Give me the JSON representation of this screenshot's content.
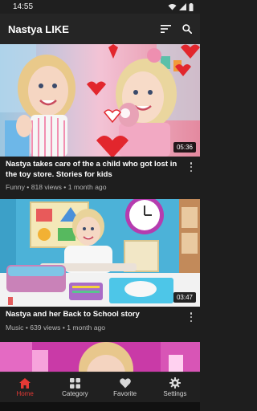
{
  "status": {
    "time": "14:55"
  },
  "app": {
    "title": "Nastya LIKE"
  },
  "videos": [
    {
      "title": "Nastya takes care of the a child who got lost in the toy store. Stories for kids",
      "category": "Funny",
      "views": "818 views",
      "age": "1 month ago",
      "duration": "05:36"
    },
    {
      "title": "Nastya and her Back to School story",
      "category": "Music",
      "views": "639 views",
      "age": "1 month ago",
      "duration": "03:47"
    }
  ],
  "nav": [
    {
      "label": "Home",
      "icon": "home-icon",
      "active": true
    },
    {
      "label": "Category",
      "icon": "grid-icon"
    },
    {
      "label": "Favorite",
      "icon": "heart-icon"
    },
    {
      "label": "Settings",
      "icon": "gear-icon"
    }
  ],
  "colors": {
    "accent": "#e53935",
    "background": "#1e1e1e",
    "appbar": "#252525"
  }
}
